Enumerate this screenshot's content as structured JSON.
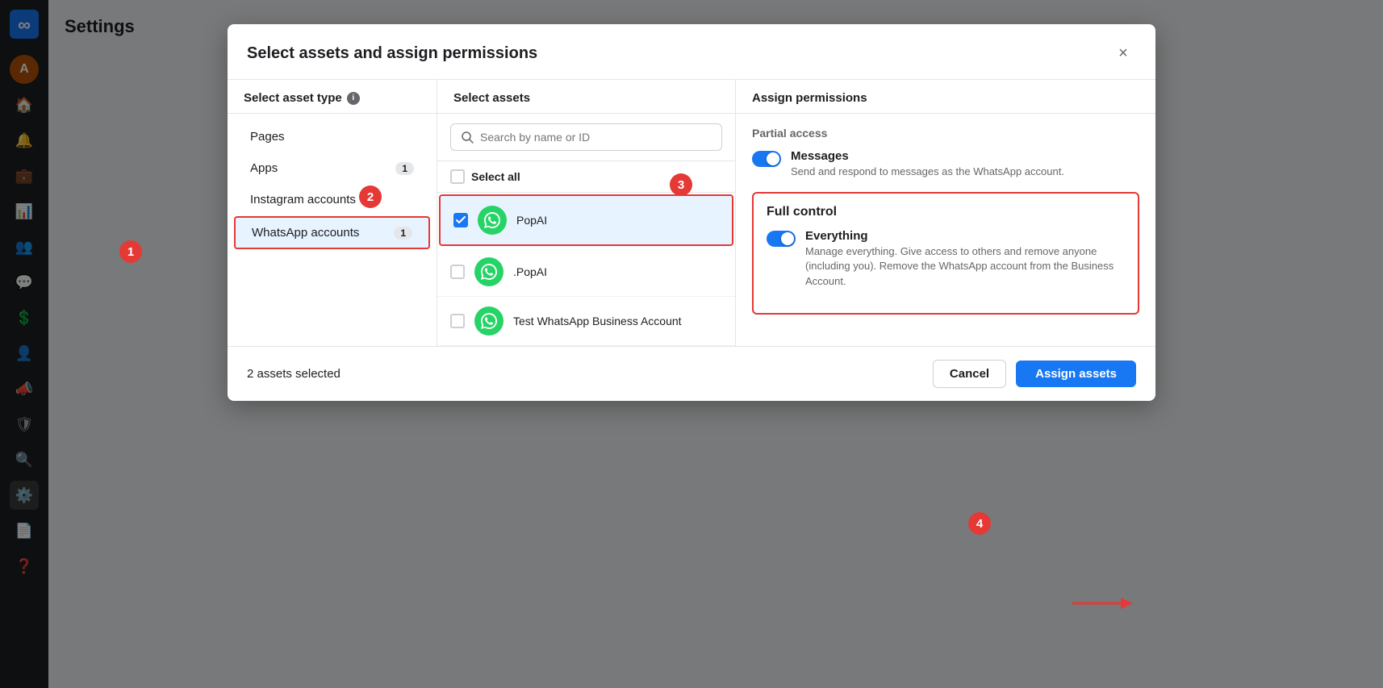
{
  "app": {
    "title": "Settings"
  },
  "modal": {
    "title": "Select assets and assign permissions",
    "close_label": "×"
  },
  "columns": {
    "asset_type": {
      "header": "Select asset type"
    },
    "select_assets": {
      "header": "Select assets",
      "search_placeholder": "Search by name or ID",
      "select_all_label": "Select all"
    },
    "assign_permissions": {
      "header": "Assign permissions"
    }
  },
  "asset_types": [
    {
      "label": "Pages",
      "badge": "",
      "active": false
    },
    {
      "label": "Apps",
      "badge": "1",
      "active": false
    },
    {
      "label": "Instagram accounts",
      "badge": "",
      "active": false
    },
    {
      "label": "WhatsApp accounts",
      "badge": "1",
      "active": true
    }
  ],
  "assets": [
    {
      "name": "PopAI",
      "selected": true,
      "id": "wa1"
    },
    {
      "name": ".PopAI",
      "selected": false,
      "id": "wa2"
    },
    {
      "name": "Test WhatsApp Business Account",
      "selected": false,
      "id": "wa3"
    }
  ],
  "permissions": {
    "partial_access_label": "Partial access",
    "messages": {
      "title": "Messages",
      "description": "Send and respond to messages as the WhatsApp account.",
      "enabled": true
    },
    "full_control_label": "Full control",
    "everything": {
      "title": "Everything",
      "description": "Manage everything. Give access to others and remove anyone (including you). Remove the WhatsApp account from the Business Account.",
      "enabled": true
    }
  },
  "footer": {
    "selected_text": "2 assets selected",
    "cancel_label": "Cancel",
    "assign_label": "Assign assets"
  },
  "steps": {
    "1": "1",
    "2": "2",
    "3": "3",
    "4": "4"
  }
}
